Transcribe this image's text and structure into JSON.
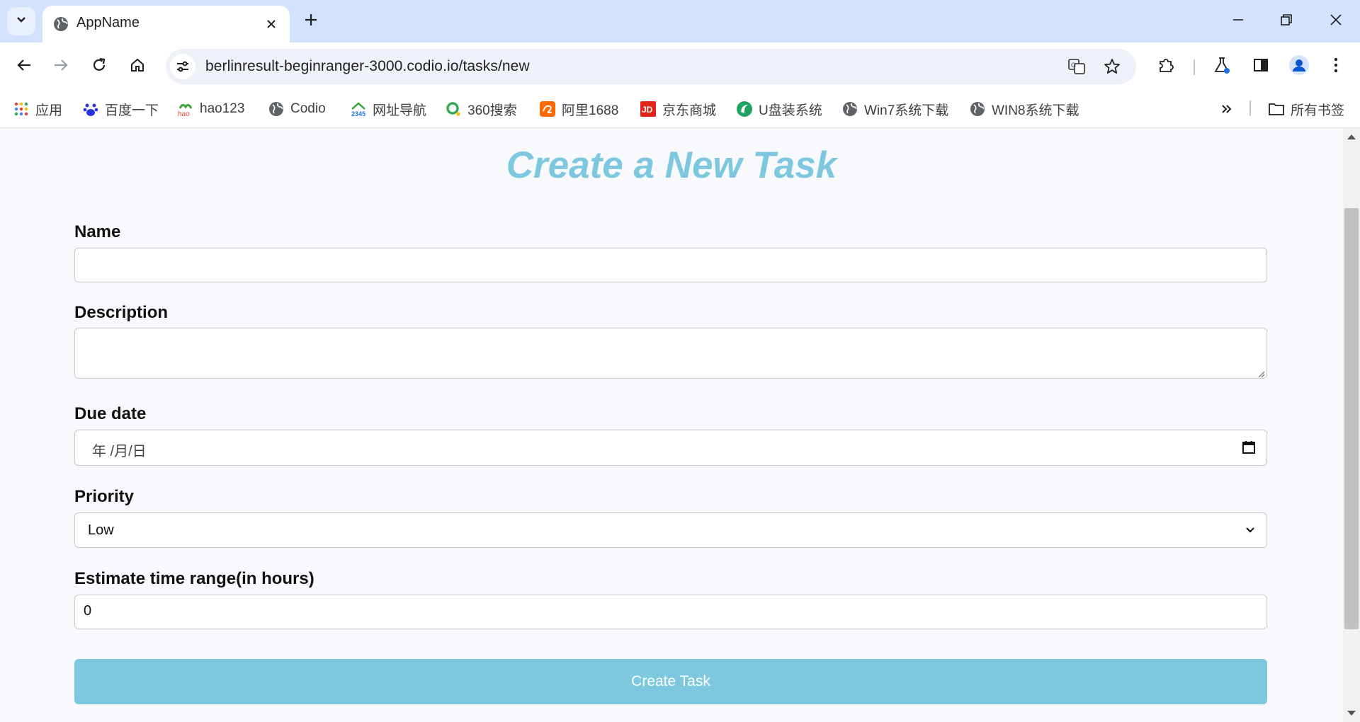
{
  "browser": {
    "tab": {
      "title": "AppName"
    },
    "address_bar": {
      "url": "berlinresult-beginranger-3000.codio.io/tasks/new"
    },
    "bookmarks": [
      {
        "label": "应用",
        "icon": "apps-grid-icon"
      },
      {
        "label": "百度一下",
        "icon": "baidu-icon"
      },
      {
        "label": "hao123",
        "icon": "hao123-icon"
      },
      {
        "label": "Codio",
        "icon": "globe-icon"
      },
      {
        "label": "网址导航",
        "icon": "2345-icon"
      },
      {
        "label": "360搜索",
        "icon": "360-icon"
      },
      {
        "label": "阿里1688",
        "icon": "1688-icon"
      },
      {
        "label": "京东商城",
        "icon": "jd-icon"
      },
      {
        "label": "U盘装系统",
        "icon": "usb-icon"
      },
      {
        "label": "Win7系统下载",
        "icon": "globe-icon"
      },
      {
        "label": "WIN8系统下载",
        "icon": "globe-icon"
      }
    ],
    "bookmarks_folder": {
      "label": "所有书签"
    },
    "colors": {
      "tabstrip": "#d3e3fd",
      "accent": "#7ec8df"
    }
  },
  "form": {
    "title": "Create a New Task",
    "name": {
      "label": "Name",
      "value": ""
    },
    "description": {
      "label": "Description",
      "value": ""
    },
    "due_date": {
      "label": "Due date",
      "placeholder": "年 /月/日"
    },
    "priority": {
      "label": "Priority",
      "selected": "Low"
    },
    "estimate": {
      "label": "Estimate time range(in hours)",
      "value": "0"
    },
    "submit_label": "Create Task"
  }
}
